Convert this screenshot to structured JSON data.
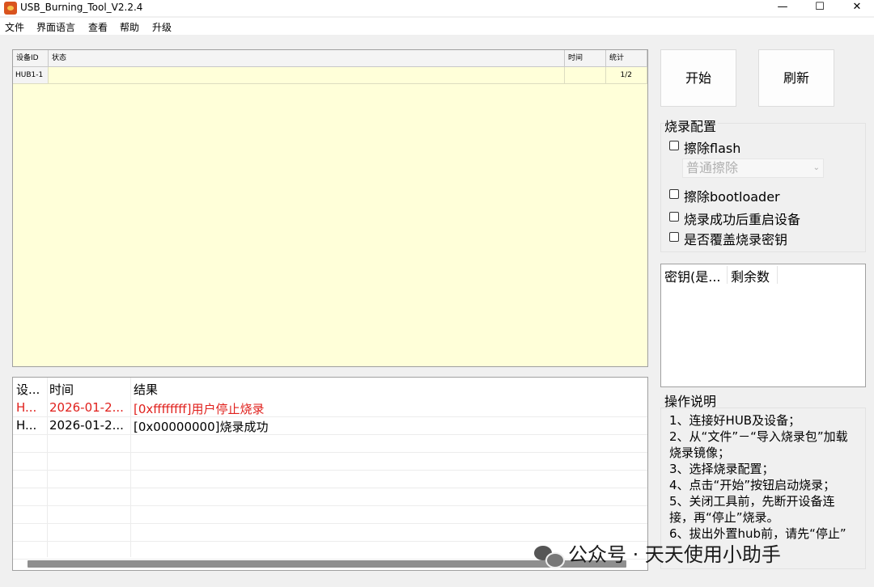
{
  "window": {
    "title": "USB_Burning_Tool_V2.2.4",
    "controls": {
      "minimize": "—",
      "maximize": "☐",
      "close": "✕"
    }
  },
  "menu": [
    "文件",
    "界面语言",
    "查看",
    "帮助",
    "升级"
  ],
  "device_grid": {
    "columns": [
      "设备ID",
      "状态",
      "时间",
      "统计"
    ],
    "rows": [
      {
        "id": "HUB1-1",
        "status": "",
        "time": "",
        "stats": "1/2"
      }
    ]
  },
  "log": {
    "columns": [
      "设...",
      "时间",
      "结果"
    ],
    "rows": [
      {
        "dev": "H...",
        "time": "2026-01-2...",
        "result": "[0xffffffff]用户停止烧录",
        "color": "#e0201c"
      },
      {
        "dev": "H...",
        "time": "2026-01-2...",
        "result": "[0x00000000]烧录成功",
        "color": "#000000"
      }
    ]
  },
  "buttons": {
    "start": "开始",
    "refresh": "刷新"
  },
  "burn_config": {
    "title": "烧录配置",
    "erase_flash": "擦除flash",
    "erase_mode": "普通擦除",
    "erase_bootloader": "擦除bootloader",
    "reboot_after": "烧录成功后重启设备",
    "overwrite_key": "是否覆盖烧录密钥"
  },
  "key_list": {
    "columns": [
      "密钥(是...",
      "剩余数"
    ]
  },
  "instructions": {
    "title": "操作说明",
    "lines": [
      "1、连接好HUB及设备；",
      "2、从“文件”－“导入烧录包”加载",
      "烧录镜像；",
      "3、选择烧录配置；",
      "4、点击“开始”按钮启动烧录；",
      "5、关闭工具前，先断开设备连",
      "接，再“停止”烧录。",
      "6、拔出外置hub前，请先“停止”"
    ]
  },
  "watermark": "公众号 · 天天使用小助手"
}
